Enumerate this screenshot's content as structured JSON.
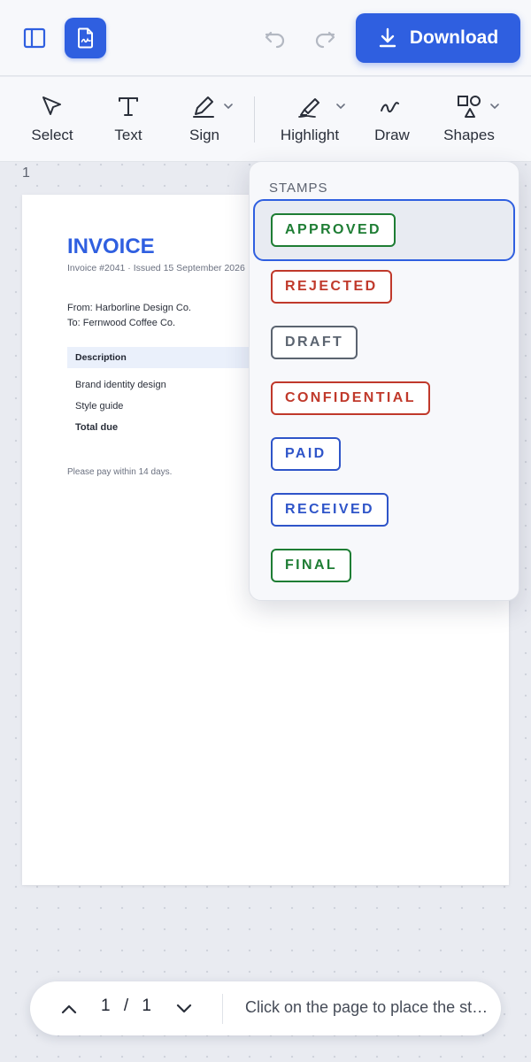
{
  "header": {
    "download_label": "Download",
    "icons": [
      "sidebar-toggle-icon",
      "document-icon",
      "undo-icon",
      "redo-icon",
      "download-icon"
    ]
  },
  "toolbar": {
    "tools": [
      {
        "label": "Select",
        "icon": "cursor-icon"
      },
      {
        "label": "Text",
        "icon": "text-icon"
      },
      {
        "label": "Sign",
        "icon": "pen-icon"
      },
      {
        "label": "Highlight",
        "icon": "highlighter-icon"
      },
      {
        "label": "Draw",
        "icon": "squiggle-icon"
      },
      {
        "label": "Shapes",
        "icon": "shapes-icon"
      }
    ]
  },
  "document": {
    "page_number": "1",
    "invoice": {
      "title": "INVOICE",
      "meta": "Invoice #2041  ·  Issued 15 September 2026",
      "from": "From: Harborline Design Co.",
      "to": "To: Fernwood Coffee Co.",
      "table_header": "Description",
      "rows": [
        "Brand identity design",
        "Style guide",
        "Total due"
      ],
      "note": "Please pay within 14 days."
    }
  },
  "stamps_menu": {
    "title": "STAMPS",
    "selected": "APPROVED",
    "items": [
      {
        "label": "APPROVED",
        "color": "#1e7d34"
      },
      {
        "label": "REJECTED",
        "color": "#c0392b"
      },
      {
        "label": "DRAFT",
        "color": "#5b6470"
      },
      {
        "label": "CONFIDENTIAL",
        "color": "#c0392b"
      },
      {
        "label": "PAID",
        "color": "#2f55c9"
      },
      {
        "label": "RECEIVED",
        "color": "#2f55c9"
      },
      {
        "label": "FINAL",
        "color": "#1e7d34"
      }
    ]
  },
  "bottom_bar": {
    "current_page": "1",
    "separator": "/",
    "total_pages": "1",
    "hint": "Click on the page to place the stamp"
  },
  "colors": {
    "accent": "#2f5fe0"
  }
}
